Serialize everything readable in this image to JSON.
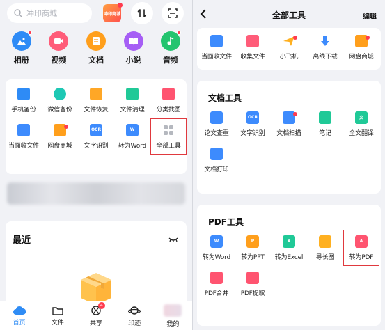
{
  "left": {
    "search_placeholder": "冲印商城",
    "promo_badge": "冲印商城",
    "categories": [
      {
        "label": "相册",
        "icon": "photo-album-icon",
        "color": "#2e8bf6"
      },
      {
        "label": "视频",
        "icon": "video-icon",
        "color": "#ff5c79"
      },
      {
        "label": "文档",
        "icon": "document-icon",
        "color": "#ff9f1c"
      },
      {
        "label": "小说",
        "icon": "book-icon",
        "color": "#a65ef5"
      },
      {
        "label": "音频",
        "icon": "music-icon",
        "color": "#23c46f"
      }
    ],
    "tools_row1": [
      "手机备份",
      "微信备份",
      "文件恢复",
      "文件清理",
      "分类找图"
    ],
    "tools_row2": [
      "当面收文件",
      "网盘商城",
      "文字识别",
      "转为Word",
      "全部工具"
    ],
    "recent_title": "最近",
    "tabs": [
      "首页",
      "文件",
      "共享",
      "印迹",
      "我的"
    ],
    "share_badge": "4"
  },
  "right": {
    "title": "全部工具",
    "edit": "编辑",
    "top_tools": [
      "当面收文件",
      "收集文件",
      "小飞机",
      "离线下载",
      "网盘商城"
    ],
    "doc_section": "文档工具",
    "doc_tools": [
      "论文查重",
      "文字识别",
      "文档扫描",
      "笔记",
      "全文翻译",
      "文档打印"
    ],
    "pdf_section": "PDF工具",
    "pdf_tools": [
      "转为Word",
      "转为PPT",
      "转为Excel",
      "导长图",
      "转为PDF",
      "PDF合并",
      "PDF提取"
    ],
    "ocr_icon_text": "OCR"
  },
  "colors": {
    "accent": "#2f8cf5",
    "highlight": "#e0393e"
  }
}
